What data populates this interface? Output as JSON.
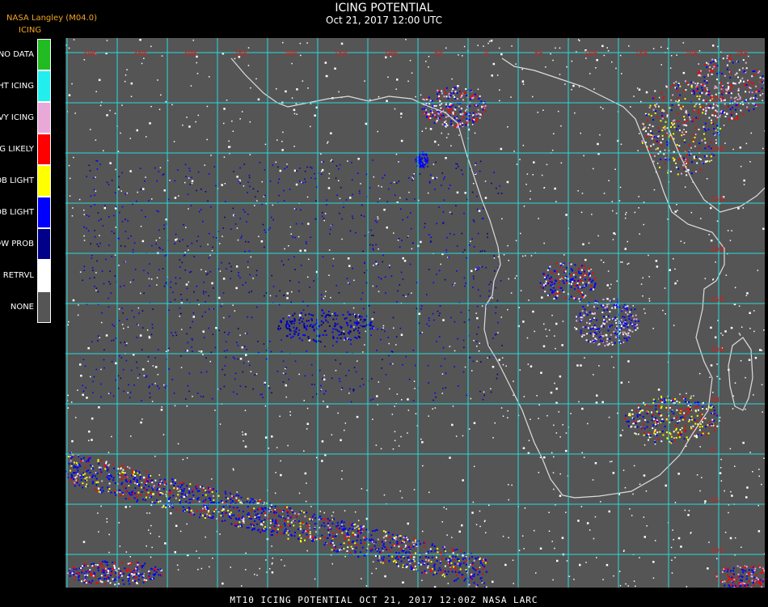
{
  "header": {
    "agency": "NASA Langley (M04.0)",
    "product": "ICING",
    "title": "ICING POTENTIAL",
    "subtitle": "Oct 21, 2017 12:00 UTC"
  },
  "legend": [
    {
      "label": "NO DATA",
      "color": "#22bb22"
    },
    {
      "label": "NIGHT ICING",
      "color": "#22eeee"
    },
    {
      "label": "HEAVY ICING",
      "color": "#e8a8d8"
    },
    {
      "label": "MOG LIKELY",
      "color": "#ff0000"
    },
    {
      "label": "HI PROB LIGHT",
      "color": "#ffff00"
    },
    {
      "label": "LO PROB LIGHT",
      "color": "#0000ff"
    },
    {
      "label": "LOW PROB",
      "color": "#00008b"
    },
    {
      "label": "NO RETRVL",
      "color": "#ffffff"
    },
    {
      "label": "NONE",
      "color": "#555555"
    }
  ],
  "map": {
    "grid_color": "#22dddd",
    "coast_color": "#dddddd",
    "lon_labels": [
      "40W",
      "35W",
      "30W",
      "25W",
      "20W",
      "15W",
      "10W",
      "5W",
      "0",
      "5E",
      "10E",
      "15E",
      "20E",
      "25E",
      "30E",
      "35E",
      "40E"
    ],
    "lat_labels": [
      "35N",
      "30N",
      "25N",
      "20N",
      "15N",
      "10N",
      "5N",
      "0",
      "5S",
      "10S",
      "15S"
    ]
  },
  "footer": {
    "text": "MT10  ICING POTENTIAL   OCT 21, 2017 12:00Z   NASA LARC"
  }
}
